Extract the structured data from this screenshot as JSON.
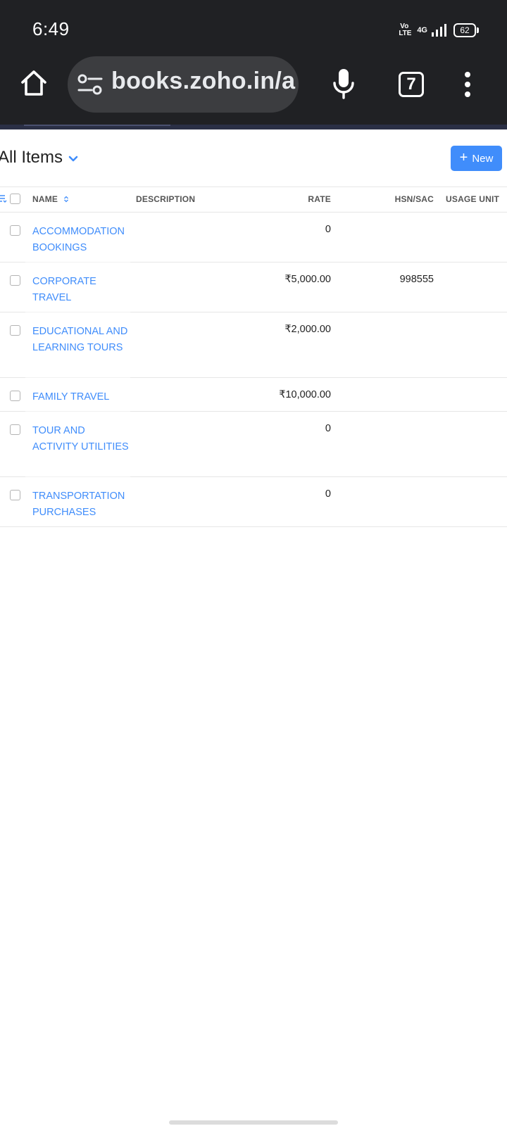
{
  "status_bar": {
    "time": "6:49",
    "volte_top": "Vo",
    "volte_bottom": "LTE",
    "network": "4G",
    "battery": "62"
  },
  "browser": {
    "url": "books.zoho.in/ap",
    "tab_count": "7",
    "icons": [
      "home-icon",
      "site-settings-icon",
      "mic-icon",
      "tabs-icon",
      "more-vert-icon"
    ]
  },
  "page": {
    "title": "All Items",
    "new_button": "New",
    "accent_color": "#408dfb"
  },
  "table": {
    "headers": {
      "name": "NAME",
      "description": "DESCRIPTION",
      "rate": "RATE",
      "hsn_sac": "HSN/SAC",
      "usage_unit": "USAGE UNIT"
    },
    "rows": [
      {
        "name": "ACCOMMODATION BOOKINGS",
        "description": "",
        "rate": "0",
        "hsn_sac": "",
        "usage_unit": ""
      },
      {
        "name": "CORPORATE TRAVEL",
        "description": "",
        "rate": "₹5,000.00",
        "hsn_sac": "998555",
        "usage_unit": ""
      },
      {
        "name": "EDUCATIONAL AND LEARNING TOURS",
        "description": "",
        "rate": "₹2,000.00",
        "hsn_sac": "",
        "usage_unit": ""
      },
      {
        "name": "FAMILY TRAVEL",
        "description": "",
        "rate": "₹10,000.00",
        "hsn_sac": "",
        "usage_unit": ""
      },
      {
        "name": "TOUR AND ACTIVITY UTILITIES",
        "description": "",
        "rate": "0",
        "hsn_sac": "",
        "usage_unit": ""
      },
      {
        "name": "TRANSPORTATION PURCHASES",
        "description": "",
        "rate": "0",
        "hsn_sac": "",
        "usage_unit": ""
      }
    ]
  }
}
